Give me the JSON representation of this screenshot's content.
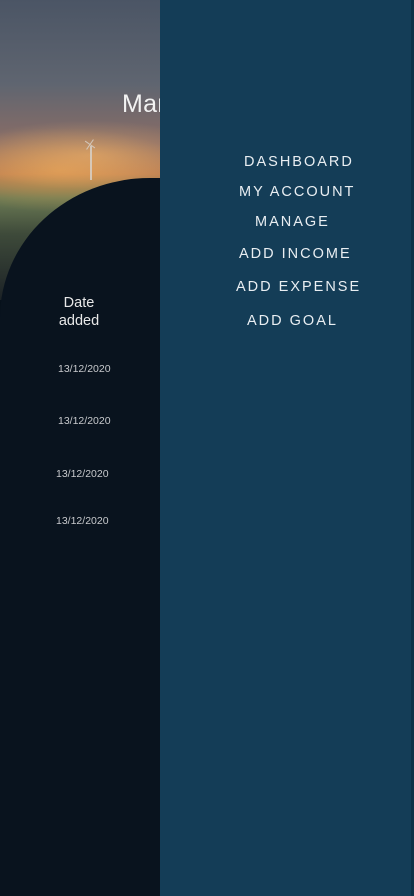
{
  "page": {
    "title_fragment": "Mar"
  },
  "table": {
    "header_line1": "Date",
    "header_line2": "added",
    "dates": [
      "13/12/2020",
      "13/12/2020",
      "13/12/2020",
      "13/12/2020"
    ]
  },
  "drawer": {
    "items": [
      {
        "label": "DASHBOARD"
      },
      {
        "label": "MY ACCOUNT"
      },
      {
        "label": "MANAGE"
      },
      {
        "label": "ADD INCOME"
      },
      {
        "label": "ADD EXPENSE"
      },
      {
        "label": "ADD GOAL"
      }
    ],
    "background_color": "#143d57"
  }
}
